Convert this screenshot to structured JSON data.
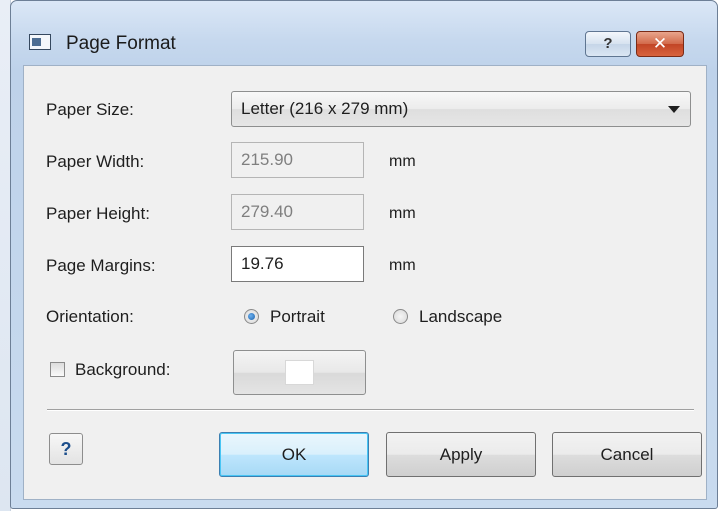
{
  "window": {
    "title": "Page Format",
    "help_button": "?",
    "close_button": "✕"
  },
  "form": {
    "paper_size": {
      "label": "Paper Size:",
      "value": "Letter (216 x 279 mm)"
    },
    "paper_width": {
      "label": "Paper Width:",
      "value": "215.90",
      "unit": "mm"
    },
    "paper_height": {
      "label": "Paper Height:",
      "value": "279.40",
      "unit": "mm"
    },
    "page_margins": {
      "label": "Page Margins:",
      "value": "19.76",
      "unit": "mm"
    },
    "orientation": {
      "label": "Orientation:",
      "options": [
        "Portrait",
        "Landscape"
      ],
      "selected": "Portrait"
    },
    "background": {
      "label": "Background:",
      "checked": false,
      "color": "#ffffff"
    }
  },
  "buttons": {
    "help_icon": "?",
    "ok": "OK",
    "apply": "Apply",
    "cancel": "Cancel"
  }
}
